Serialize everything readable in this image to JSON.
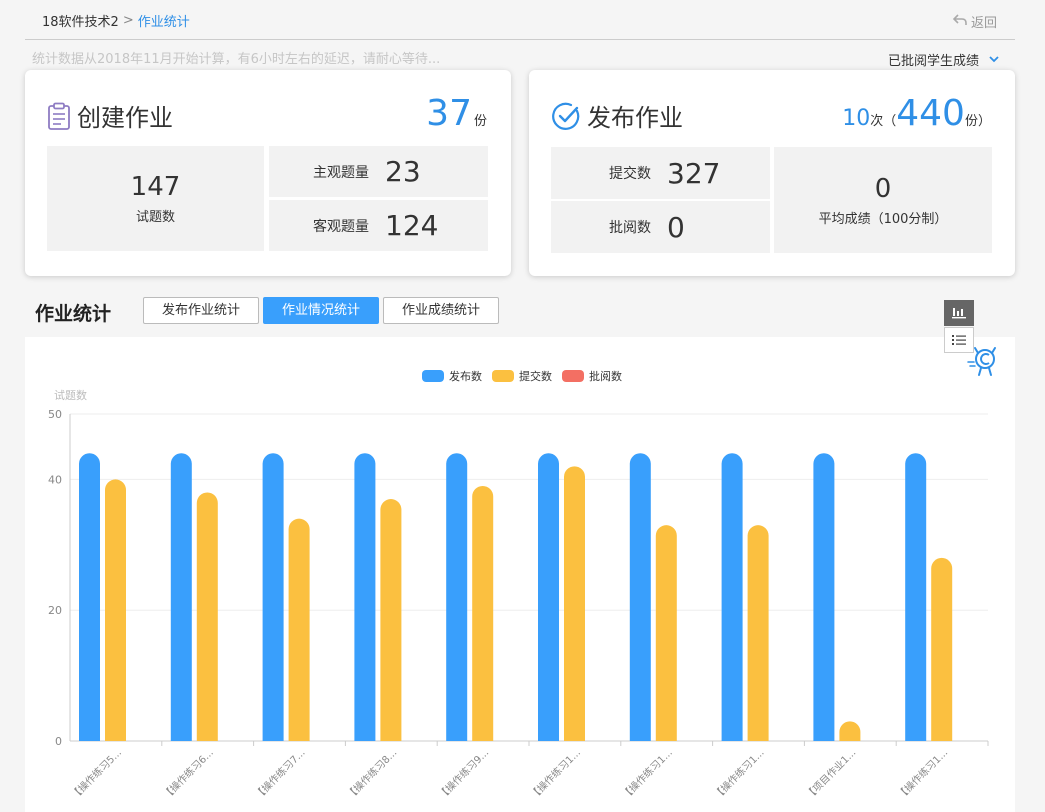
{
  "breadcrumb": {
    "course": "18软件技术2",
    "separator": ">",
    "current": "作业统计"
  },
  "back_label": "返回",
  "notice": "统计数据从2018年11月开始计算，有6小时左右的延迟，请耐心等待...",
  "filter": {
    "selected": "已批阅学生成绩"
  },
  "create_card": {
    "title": "创建作业",
    "total": "37",
    "total_unit": "份",
    "questions_count": "147",
    "questions_label": "试题数",
    "subjective_label": "主观题量",
    "subjective_value": "23",
    "objective_label": "客观题量",
    "objective_value": "124"
  },
  "publish_card": {
    "title": "发布作业",
    "times": "10",
    "times_unit": "次",
    "paren_open": "（",
    "copies": "440",
    "copies_unit": "份",
    "paren_close": "）",
    "submit_label": "提交数",
    "submit_value": "327",
    "review_label": "批阅数",
    "review_value": "0",
    "avg_value": "0",
    "avg_label": "平均成绩（100分制）"
  },
  "stats": {
    "title": "作业统计",
    "tabs": [
      "发布作业统计",
      "作业情况统计",
      "作业成绩统计"
    ],
    "active_tab": 1,
    "view_icons": [
      "bar-chart-icon",
      "list-icon"
    ]
  },
  "colors": {
    "accent": "#2f8fe6",
    "published": "#399ffc",
    "submitted": "#fbc040",
    "reviewed": "#f36f63"
  },
  "chart_data": {
    "type": "bar",
    "ylabel": "试题数",
    "ylim": [
      0,
      50
    ],
    "yticks": [
      0,
      20,
      40,
      50
    ],
    "legend_position": "top-center",
    "categories": [
      "【操作练习5...",
      "【操作练习6...",
      "【操作练习7...",
      "【操作练习8...",
      "【操作练习9...",
      "【操作练习1...",
      "【操作练习1...",
      "【操作练习1...",
      "【项目作业1...",
      "【操作练习1..."
    ],
    "series": [
      {
        "name": "发布数",
        "color": "#399ffc",
        "values": [
          44,
          44,
          44,
          44,
          44,
          44,
          44,
          44,
          44,
          44
        ]
      },
      {
        "name": "提交数",
        "color": "#fbc040",
        "values": [
          40,
          38,
          34,
          37,
          39,
          42,
          33,
          33,
          3,
          28
        ]
      },
      {
        "name": "批阅数",
        "color": "#f36f63",
        "values": [
          0,
          0,
          0,
          0,
          0,
          0,
          0,
          0,
          0,
          0
        ]
      }
    ]
  }
}
